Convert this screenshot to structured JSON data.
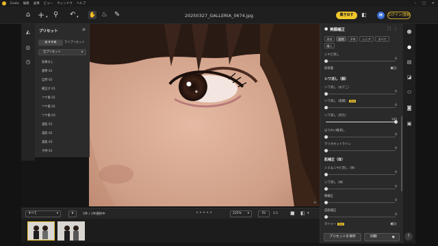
{
  "titlebar": {
    "app": "Evoto",
    "menus": [
      "編集",
      "画像",
      "ビュー",
      "ウィンドウ",
      "ヘルプ"
    ]
  },
  "toolbar": {
    "filename": "20250327_GALLERIA_0674.jpg",
    "export_label": "書き出す",
    "avatar_letter": "H",
    "account_label": "ログイン/登録"
  },
  "preset_panel": {
    "title": "プリセット",
    "tabs": [
      "おすすめ",
      "マイプリセット"
    ],
    "filter": "全プリセット",
    "items": [
      "効果なし",
      "基準 01",
      "自然 02",
      "補正け 01",
      "ツヤ肌 01",
      "ツヤ肌 02",
      "ツヤ肌 03",
      "美肌 01",
      "美肌 02",
      "美肌 03",
      "子供 01"
    ]
  },
  "bottom": {
    "filter_label": "すべて",
    "count": "2件 / 1件選択中",
    "zoom": "225%",
    "fit": "Fit",
    "ratio": "1:1"
  },
  "right_panel": {
    "title": "美顔補正",
    "tabs": [
      "男性",
      "女性",
      "子供",
      "シニア",
      "すべて",
      "購入"
    ],
    "rows": [
      {
        "label": "ニキビ消し",
        "value": "0"
      },
      {
        "label": "肌保護",
        "toggle": true
      },
      {
        "section": "シワ消し（顔）"
      },
      {
        "label": "シワ消し（おでこ）",
        "value": "0"
      },
      {
        "label": "シワ消し（眉間）",
        "value": "0",
        "badge": "New"
      },
      {
        "label": "シワ消し（目元）",
        "value": "100"
      },
      {
        "label": "ほうれい線消し",
        "value": "0"
      },
      {
        "label": "マリオネットライン",
        "value": "0"
      },
      {
        "section": "肌補正（体）"
      },
      {
        "label": "シミ＆ニキビ消し（体）",
        "value": "0"
      },
      {
        "label": "シワ消し（体）",
        "value": "0"
      },
      {
        "label": "胸補正",
        "value": "0"
      },
      {
        "label": "首筋補正",
        "value": "0"
      },
      {
        "label": "タトゥー",
        "toggle": true,
        "badge": "New"
      }
    ],
    "save_label": "プリセットを保存",
    "sync_label": "同期"
  },
  "slider_levels": {
    "r1": 0,
    "r4": 0,
    "r5": 0,
    "r6": 100,
    "r7": 0,
    "r8": 0,
    "r10": 0,
    "r11": 0,
    "r12": 0,
    "r13": 0
  }
}
